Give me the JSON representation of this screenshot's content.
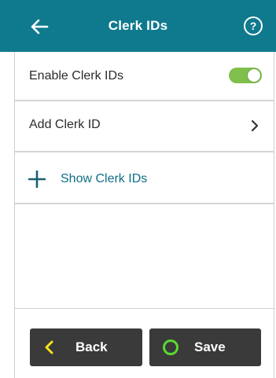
{
  "header": {
    "title": "Clerk IDs",
    "back_icon": "arrow-left-icon",
    "help_label": "?",
    "color": "#0f7a8e"
  },
  "settings": {
    "enable_label": "Enable Clerk IDs",
    "enable_toggle_on": true,
    "add_label": "Add Clerk ID",
    "add_icon": "chevron-right-icon",
    "show_label": "Show Clerk IDs",
    "show_icon": "plus-icon"
  },
  "footer": {
    "back_label": "Back",
    "back_icon": "chevron-left-icon",
    "save_label": "Save",
    "save_icon": "circle-icon",
    "button_color": "#3a3a3a",
    "back_icon_color": "#f5e31a",
    "save_icon_color": "#59d92f"
  },
  "colors": {
    "toggle_on": "#7fc04d",
    "link_text": "#0f6f86"
  }
}
